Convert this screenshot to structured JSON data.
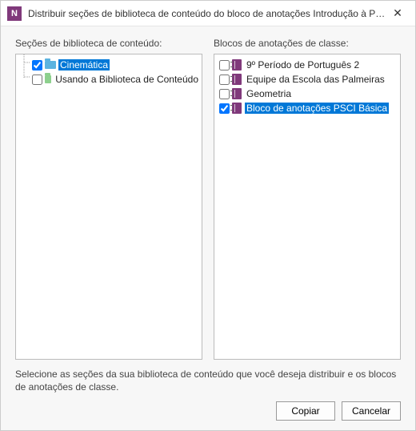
{
  "titlebar": {
    "app_icon_text": "N",
    "title": "Distribuir seções de biblioteca de conteúdo do bloco de anotações Introdução à PSCI",
    "close_symbol": "✕"
  },
  "left_pane": {
    "header": "Seções de biblioteca de conteúdo:",
    "items": [
      {
        "label": "Cinemática",
        "checked": true,
        "selected": true,
        "color": "#5bb3e0"
      },
      {
        "label": "Usando a Biblioteca de Conteúdo",
        "checked": false,
        "selected": false,
        "color": "#8dd08d"
      }
    ]
  },
  "right_pane": {
    "header": "Blocos de anotações de classe:",
    "items": [
      {
        "label": "9º Período de Português 2",
        "checked": false,
        "selected": false,
        "color": "#80397B"
      },
      {
        "label": "Equipe da Escola das Palmeiras",
        "checked": false,
        "selected": false,
        "color": "#80397B"
      },
      {
        "label": "Geometria",
        "checked": false,
        "selected": false,
        "color": "#80397B"
      },
      {
        "label": "Bloco de anotações PSCI Básica",
        "checked": true,
        "selected": true,
        "color": "#80397B"
      }
    ]
  },
  "instruction": "Selecione as seções da sua biblioteca de conteúdo que você deseja distribuir e os blocos de anotações de classe.",
  "buttons": {
    "copy": "Copiar",
    "cancel": "Cancelar"
  }
}
